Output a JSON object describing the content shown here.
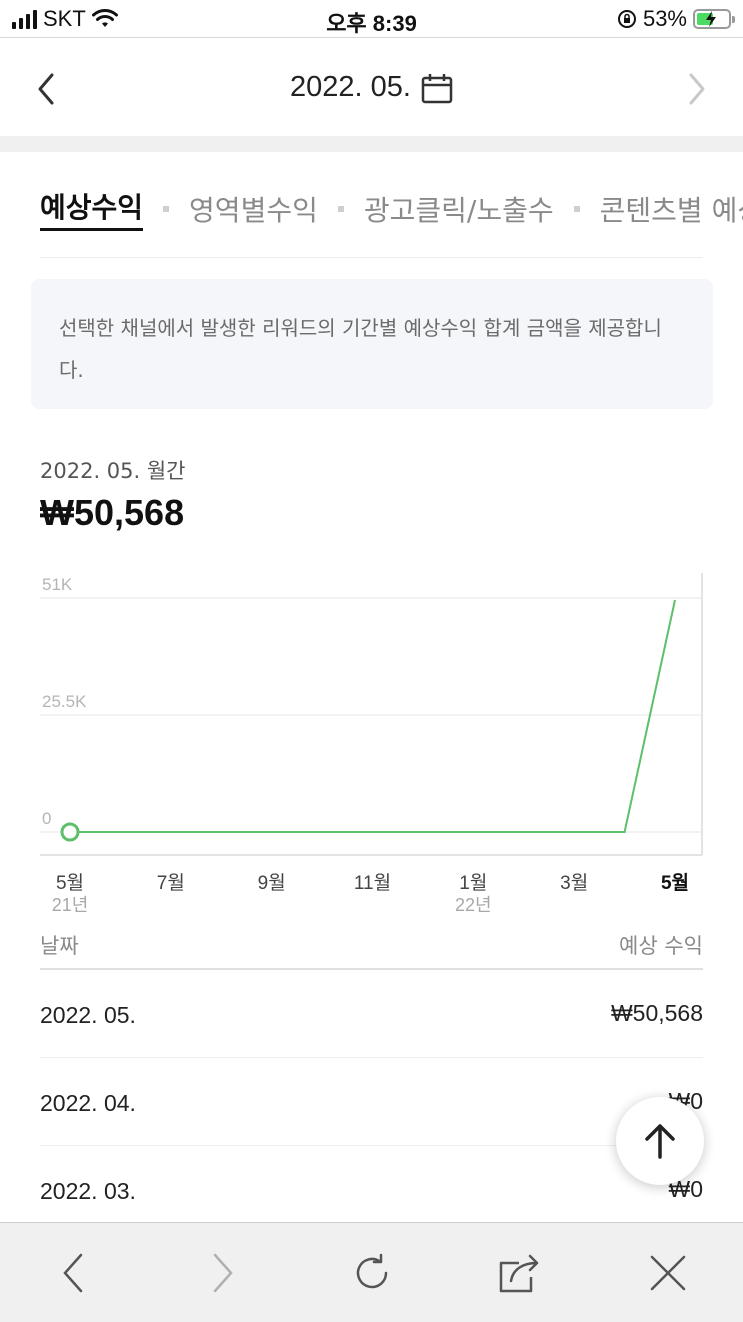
{
  "status_bar": {
    "carrier": "SKT",
    "time": "오후 8:39",
    "battery": "53%",
    "battery_level": 0.53
  },
  "header": {
    "title": "2022. 05.",
    "prev_icon": "chevron-left-icon",
    "calendar_icon": "calendar-icon",
    "next_icon": "chevron-right-icon"
  },
  "tabs": [
    {
      "label": "예상수익",
      "active": true
    },
    {
      "label": "영역별수익",
      "active": false
    },
    {
      "label": "광고클릭/노출수",
      "active": false
    },
    {
      "label": "콘텐츠별 예상",
      "active": false
    }
  ],
  "info": {
    "text": "선택한 채널에서 발생한 리워드의 기간별 예상수익 합계 금액을 제공합니다."
  },
  "summary": {
    "period": "2022. 05. 월간",
    "amount": "₩50,568"
  },
  "chart_data": {
    "type": "line",
    "x": [
      "21년 5월",
      "21년 6월",
      "21년 7월",
      "21년 8월",
      "21년 9월",
      "21년 10월",
      "21년 11월",
      "21년 12월",
      "22년 1월",
      "22년 2월",
      "22년 3월",
      "22년 4월",
      "22년 5월"
    ],
    "tick_labels": [
      {
        "index": 0,
        "month": "5월",
        "year": "21년"
      },
      {
        "index": 2,
        "month": "7월",
        "year": ""
      },
      {
        "index": 4,
        "month": "9월",
        "year": ""
      },
      {
        "index": 6,
        "month": "11월",
        "year": ""
      },
      {
        "index": 8,
        "month": "1월",
        "year": "22년"
      },
      {
        "index": 10,
        "month": "3월",
        "year": ""
      },
      {
        "index": 12,
        "month": "5월",
        "year": ""
      }
    ],
    "series": [
      {
        "values": [
          0,
          0,
          0,
          0,
          0,
          0,
          0,
          0,
          0,
          0,
          0,
          0,
          50568
        ]
      }
    ],
    "y_ticks": [
      "0",
      "25.5K",
      "51K"
    ],
    "ylim": [
      0,
      51000
    ],
    "grid": true,
    "highlighted_index": 12,
    "line_color": "#5cbf6a"
  },
  "table": {
    "col_date": "날짜",
    "col_value": "예상 수익",
    "rows": [
      {
        "date": "2022. 05.",
        "value": "₩50,568"
      },
      {
        "date": "2022. 04.",
        "value": "₩0"
      },
      {
        "date": "2022. 03.",
        "value": "₩0"
      }
    ]
  },
  "scroll_top_icon": "arrow-up-icon",
  "toolbar": [
    "back-icon",
    "forward-icon",
    "reload-icon",
    "share-icon",
    "close-icon"
  ]
}
